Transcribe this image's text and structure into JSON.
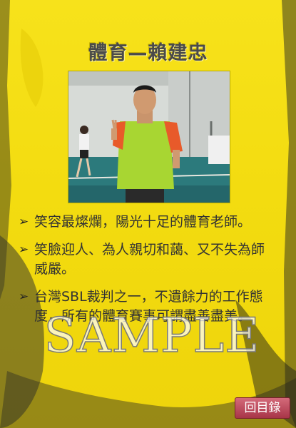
{
  "slide": {
    "title": "體育—賴建忠",
    "photo_icon": "teacher-photo"
  },
  "bullets": [
    "笑容最燦爛，陽光十足的體育老師。",
    "笑臉迎人、為人親切和藹、又不失為師威嚴。",
    "台灣SBL裁判之一，不遺餘力的工作態度，所有的體育賽事可謂盡善盡美。"
  ],
  "bullet_marker": "➢",
  "watermark": "SAMPLE",
  "nav": {
    "back_label": "回目錄"
  },
  "colors": {
    "background": "#f3dc10",
    "button": "#b84a5a",
    "title": "#4a4a4a"
  }
}
